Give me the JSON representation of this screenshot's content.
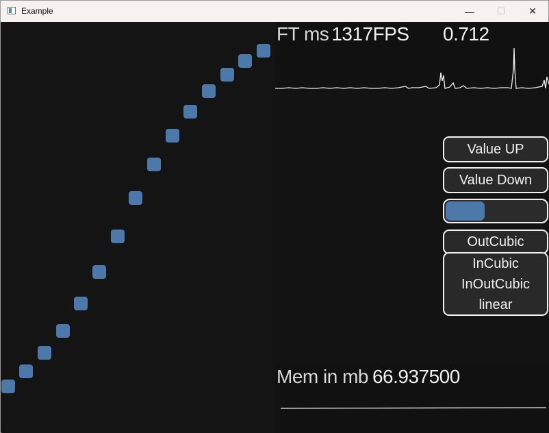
{
  "window": {
    "title": "Example",
    "minimize_glyph": "—",
    "maximize_glyph": "☐",
    "close_glyph": "✕"
  },
  "stats": {
    "ft_label": "FT ms",
    "fps": "1317FPS",
    "ft_value": "0.712"
  },
  "buttons": {
    "value_up": "Value UP",
    "value_down": "Value Down",
    "selected_easing": "OutCubic"
  },
  "progress": {
    "fraction": 0.39
  },
  "easing_options": [
    "InCubic",
    "InOutCubic",
    "linear"
  ],
  "memory": {
    "label": "Mem in mb",
    "value": "66.937500"
  },
  "colors": {
    "accent": "#4d78aa",
    "background": "#131313",
    "border": "#f2f2f2"
  }
}
